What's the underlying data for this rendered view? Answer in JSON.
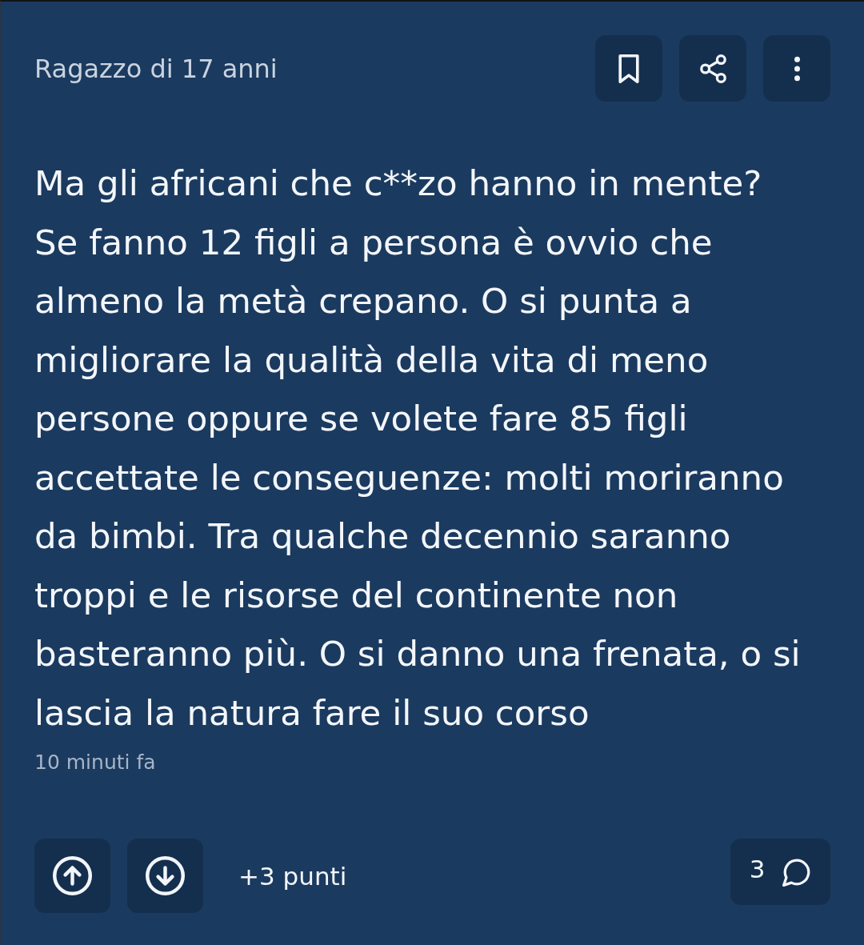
{
  "post": {
    "author": "Ragazzo di 17 anni",
    "actions": [
      {
        "kind": "bookmark"
      },
      {
        "kind": "share"
      },
      {
        "kind": "more"
      }
    ],
    "body": "Ma gli africani che c**zo hanno in mente?\nSe fanno 12 figli a persona è ovvio che almeno la metà crepano. O si punta a migliorare la qualità della vita di meno persone oppure se volete fare 85 figli accettate le conseguenze: molti moriranno da bimbi. Tra qualche decennio saranno troppi e le risorse del continente non basteranno più. O si danno una frenata, o si lascia la natura fare il suo corso",
    "time": "10 minuti fa"
  },
  "footer": {
    "votes": [
      {
        "kind": "up"
      },
      {
        "kind": "down"
      }
    ],
    "score": "+3 punti",
    "comments": "3"
  }
}
